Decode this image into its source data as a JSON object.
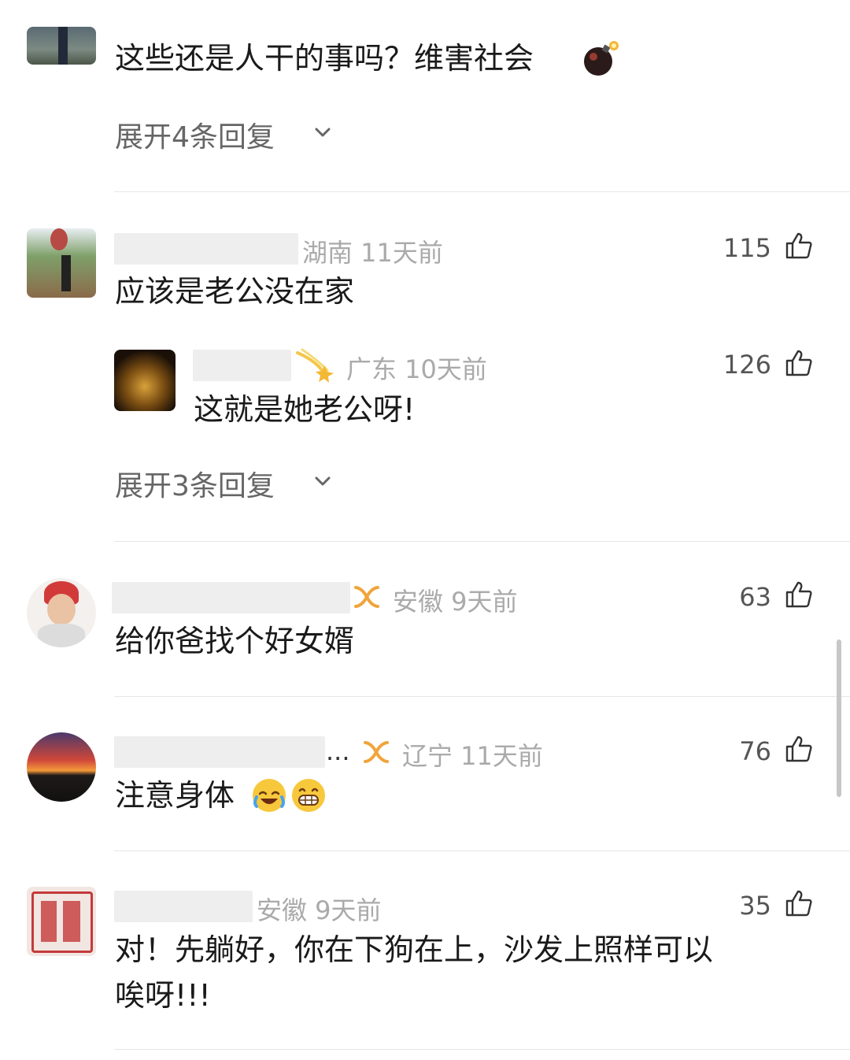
{
  "comments": [
    {
      "text": "这些还是人干的事吗？维害社会",
      "expand_label": "展开4条回复"
    },
    {
      "location_time": "湖南 11天前",
      "likes": "115",
      "text": "应该是老公没在家",
      "reply": {
        "location_time": "广东 10天前",
        "likes": "126",
        "text": "这就是她老公呀!"
      },
      "expand_label": "展开3条回复"
    },
    {
      "location_time": "安徽 9天前",
      "likes": "63",
      "text": "给你爸找个好女婿"
    },
    {
      "name_suffix": "...",
      "location_time": "辽宁 11天前",
      "likes": "76",
      "text": "注意身体"
    },
    {
      "location_time": "安徽 9天前",
      "likes": "35",
      "text_line1": "对！先躺好，你在下狗在上，沙发上照样可以",
      "text_line2": "唉呀!!!"
    }
  ],
  "icons": {
    "like": "thumbs-up-icon",
    "expand": "chevron-down-icon",
    "vip": "infinity-badge-icon",
    "bomb": "bomb-emoji",
    "comet": "comet-badge-icon",
    "laugh": "rolling-laughing-emoji",
    "grin": "grinning-emoji"
  },
  "colors": {
    "text": "#1a1a1a",
    "meta": "#aaaaaa",
    "badge": "#f0a43a"
  }
}
